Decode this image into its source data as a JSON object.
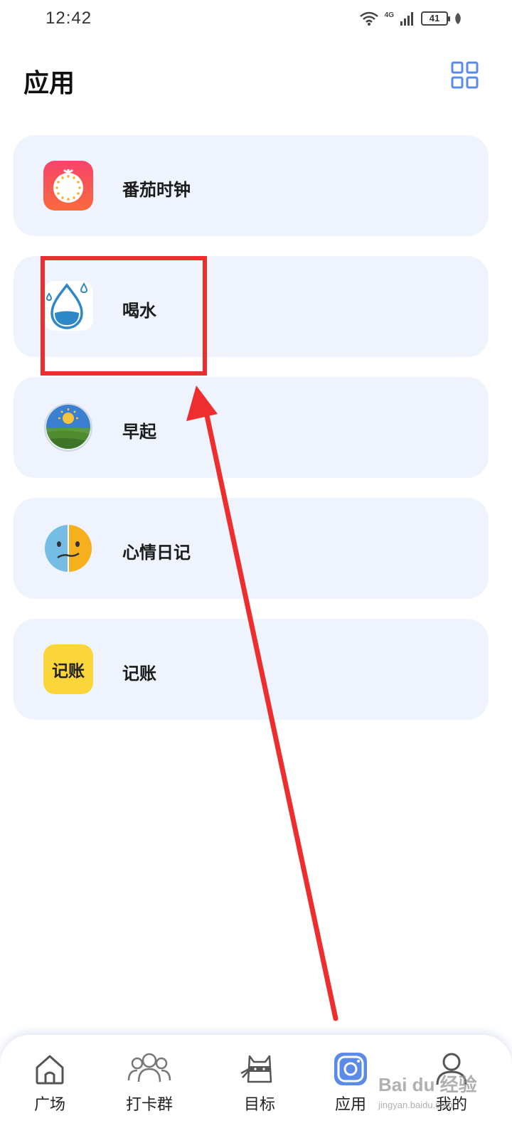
{
  "status_bar": {
    "time": "12:42",
    "network": "4G",
    "battery": "41"
  },
  "header": {
    "title": "应用"
  },
  "apps": [
    {
      "label": "番茄时钟",
      "icon": "tomato-clock-icon"
    },
    {
      "label": "喝水",
      "icon": "water-drop-icon"
    },
    {
      "label": "早起",
      "icon": "sunrise-icon"
    },
    {
      "label": "心情日记",
      "icon": "mood-face-icon"
    },
    {
      "label": "记账",
      "icon": "bookkeeping-icon",
      "icon_text": "记账"
    }
  ],
  "bottom_nav": [
    {
      "label": "广场",
      "icon": "home-icon"
    },
    {
      "label": "打卡群",
      "icon": "group-icon"
    },
    {
      "label": "目标",
      "icon": "ninja-cat-icon"
    },
    {
      "label": "应用",
      "icon": "app-camera-icon",
      "active": true
    },
    {
      "label": "我的",
      "icon": "profile-icon"
    }
  ],
  "watermark": {
    "main": "Bai du 经验",
    "sub": "jingyan.baidu.com"
  },
  "colors": {
    "card_bg": "#eef3fd",
    "accent_blue": "#5b8be6",
    "annotation_red": "#ee2e2e"
  }
}
